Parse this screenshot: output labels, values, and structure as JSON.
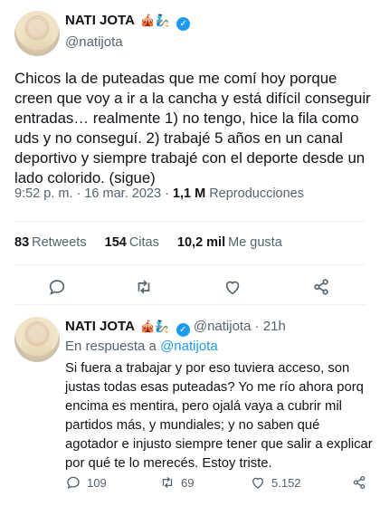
{
  "tweet": {
    "name": "NATI JOTA",
    "emojis": "🎪🧞",
    "handle": "@natijota",
    "text": "Chicos la de puteadas que me comí hoy porque creen que voy a ir a la cancha y está difícil conseguir entradas… realmente 1) no tengo, hice la fila como uds y no conseguí. 2) trabajé 5 años en un canal deportivo y siempre trabajé con el deporte desde un lado colorido. (sigue)",
    "time": "9:52 p. m. · 16 mar. 2023 · ",
    "views_count": "1,1 M",
    "views_label": "Reproducciones",
    "retweets_count": "83",
    "retweets_label": "Retweets",
    "quotes_count": "154",
    "quotes_label": "Citas",
    "likes_count": "10,2 mil",
    "likes_label": "Me gusta"
  },
  "reply": {
    "name": "NATI JOTA",
    "emojis": "🎪🧞",
    "handle_time": "@natijota · 21h",
    "reply_prefix": "En respuesta a ",
    "reply_to": "@natijota",
    "text": "Si fuera a trabajar y por eso tuviera acceso, son justas todas esas puteadas? Yo me río ahora porq encima es mentira, pero ojalá vaya a cubrir mil partidos más, y mundiales; y no saben qué agotador e injusto siempre tener que salir a explicar por qué te lo merecés. Estoy triste.",
    "replies": "109",
    "retweets": "69",
    "likes": "5.152"
  },
  "colors": {
    "accent": "#1d9bf0",
    "muted": "#536471",
    "text": "#0f1419"
  },
  "icons": [
    "verified-icon",
    "reply-icon",
    "retweet-icon",
    "like-icon",
    "share-icon"
  ]
}
